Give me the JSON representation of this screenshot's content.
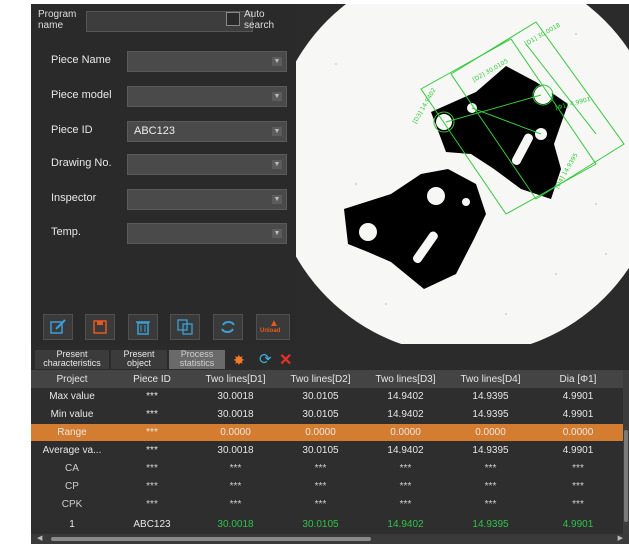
{
  "program": {
    "label": "Program name",
    "value": "",
    "auto_search_label": "Auto search"
  },
  "fields": [
    {
      "label": "Piece Name",
      "value": ""
    },
    {
      "label": "Piece model",
      "value": ""
    },
    {
      "label": "Piece ID",
      "value": "ABC123"
    },
    {
      "label": "Drawing No.",
      "value": ""
    },
    {
      "label": "Inspector",
      "value": ""
    },
    {
      "label": "Temp.",
      "value": ""
    }
  ],
  "toolbar": {
    "edit": "edit-icon",
    "save": "save-icon",
    "delete": "trash-icon",
    "copy": "copy-icon",
    "refresh": "refresh-icon",
    "unload_label": "Unload"
  },
  "viewer": {
    "dims": [
      "[D1] 30.0018",
      "[D2] 30.0105",
      "[D3] 14.9402",
      "[D4] 14.9395",
      "[Φ1] 4.9901"
    ]
  },
  "tabs": [
    {
      "label": "Present characteristics"
    },
    {
      "label": "Present object"
    },
    {
      "label": "Process statistics"
    }
  ],
  "tab_icons": {
    "gear": "gear-icon",
    "refresh": "refresh-icon",
    "close": "close-icon"
  },
  "colors": {
    "accent": "#d47d30",
    "pass": "#30c24a",
    "gear": "#f07a28",
    "refresh": "#3ab0e0",
    "close": "#e8302a"
  },
  "table": {
    "headers": [
      "Project",
      "Piece ID",
      "Two lines[D1]",
      "Two lines[D2]",
      "Two lines[D3]",
      "Two lines[D4]",
      "Dia [Φ1]"
    ],
    "rows": [
      {
        "cells": [
          "Max value",
          "***",
          "30.0018",
          "30.0105",
          "14.9402",
          "14.9395",
          "4.9901"
        ]
      },
      {
        "cells": [
          "Min value",
          "***",
          "30.0018",
          "30.0105",
          "14.9402",
          "14.9395",
          "4.9901"
        ]
      },
      {
        "cells": [
          "Range",
          "***",
          "0.0000",
          "0.0000",
          "0.0000",
          "0.0000",
          "0.0000"
        ]
      },
      {
        "cells": [
          "Average va...",
          "***",
          "30.0018",
          "30.0105",
          "14.9402",
          "14.9395",
          "4.9901"
        ]
      },
      {
        "cells": [
          "CA",
          "***",
          "***",
          "***",
          "***",
          "***",
          "***"
        ]
      },
      {
        "cells": [
          "CP",
          "***",
          "***",
          "***",
          "***",
          "***",
          "***"
        ]
      },
      {
        "cells": [
          "CPK",
          "***",
          "***",
          "***",
          "***",
          "***",
          "***"
        ]
      },
      {
        "cells": [
          "1",
          "ABC123",
          "30.0018",
          "30.0105",
          "14.9402",
          "14.9395",
          "4.9901"
        ]
      }
    ]
  }
}
